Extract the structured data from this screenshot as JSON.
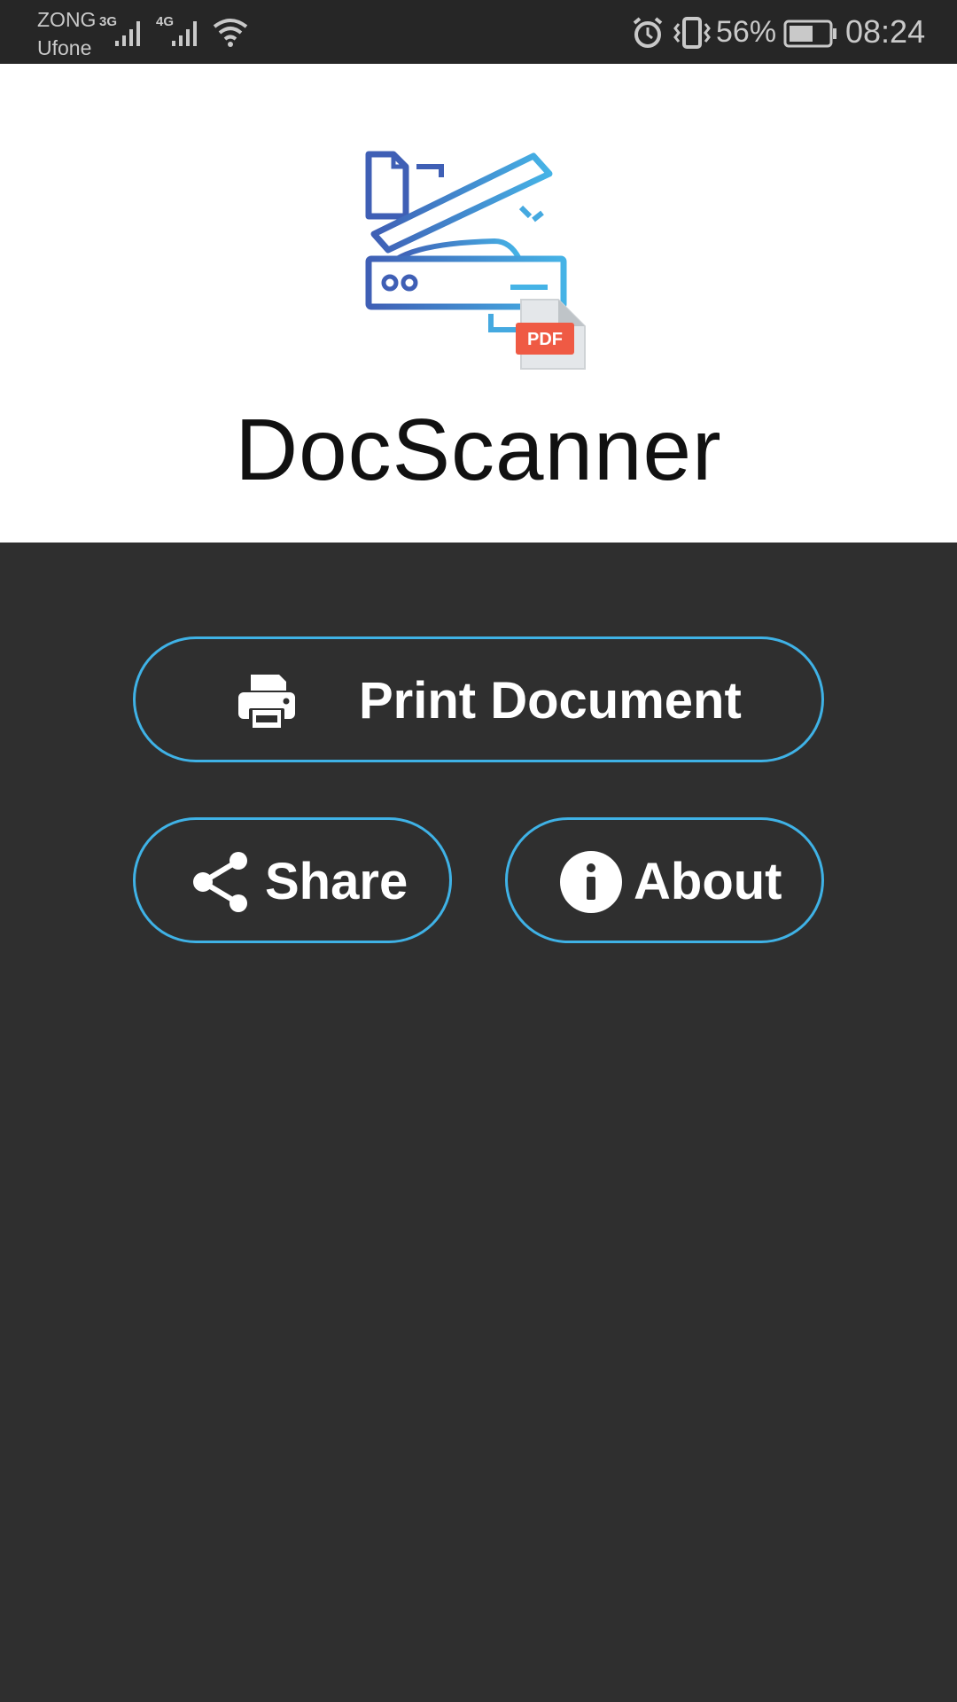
{
  "status_bar": {
    "carrier_1": "ZONG",
    "carrier_2": "Ufone",
    "network_1": "3G",
    "network_2": "4G",
    "battery_percent": "56%",
    "time": "08:24",
    "icons": [
      "signal-icon",
      "wifi-icon",
      "alarm-icon",
      "vibrate-icon",
      "battery-icon"
    ]
  },
  "header": {
    "logo_badge": "PDF",
    "title": "DocScanner"
  },
  "actions": {
    "print_label": "Print Document",
    "share_label": "Share",
    "about_label": "About"
  },
  "colors": {
    "accent": "#3fb2e6",
    "background": "#2f2f2f",
    "header_background": "#ffffff",
    "pdf_badge": "#ef5a44"
  }
}
